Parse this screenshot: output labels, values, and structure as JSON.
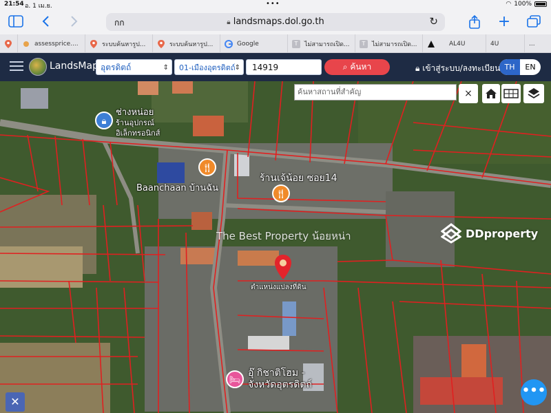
{
  "status": {
    "time": "21:54",
    "date": "อ. 1 เม.ย.",
    "battery": "100%"
  },
  "browser": {
    "text_size": "กก",
    "url": "landsmaps.dol.go.th",
    "tabs": [
      {
        "label": "",
        "icon": "map-pin-icon",
        "color": "#e8684a"
      },
      {
        "label": "assessprice....",
        "icon": "sun-icon",
        "color": "#e8a34a"
      },
      {
        "label": "ระบบค้นหารูป...",
        "icon": "map-pin-icon",
        "color": "#e8684a"
      },
      {
        "label": "ระบบค้นหารูป...",
        "icon": "map-pin-icon",
        "color": "#e8684a"
      },
      {
        "label": "Google",
        "icon": "google-icon",
        "color": "#4285f4"
      },
      {
        "label": "ไม่สามารถเปิด...",
        "icon": "tab-t-icon",
        "color": "#bdbdc4"
      },
      {
        "label": "ไม่สามารถเปิด...",
        "icon": "tab-t-icon",
        "color": "#bdbdc4"
      },
      {
        "label": "AL4U",
        "icon": "triangle-icon",
        "color": "#111111"
      },
      {
        "label": "4U",
        "icon": "",
        "color": "#bdbdc4"
      },
      {
        "label": "...",
        "icon": "",
        "color": "#bdbdc4"
      }
    ]
  },
  "app": {
    "brand": "LandsMaps",
    "province": "อุตรดิตถ์",
    "district": "01-เมืองอุตรดิตถ์",
    "parcel_no": "14919",
    "search_label": "ค้นหา",
    "login_label": "เข้าสู่ระบบ/ลงทะเบียน",
    "lang_th": "TH",
    "lang_en": "EN"
  },
  "map": {
    "place_search_placeholder": "ค้นหาสถานที่สำคัญ",
    "close": "×",
    "labels": {
      "shop": "ช่างหน่อย ร้านอุปกรณ์ อิเล็กทรอนิกส์",
      "shop_l1": "ช่างหน่อย",
      "shop_l2": "ร้านอุปกรณ์",
      "shop_l3": "อิเล็กทรอนิกส์",
      "baanchaan": "Baanchaan บ้านฉัน",
      "jenoi": "ร้านเจ้น้อย ซอย14",
      "pin": "ตำแหน่งแปลงที่ดิน",
      "home_l1": "อุ๊ กิชาติโฮม -",
      "home_l2": "จังหวัดอุตรดิตถ์"
    },
    "watermark": "The Best Property น้อยหน่า",
    "ddproperty": "DDproperty",
    "fab": "•••"
  }
}
